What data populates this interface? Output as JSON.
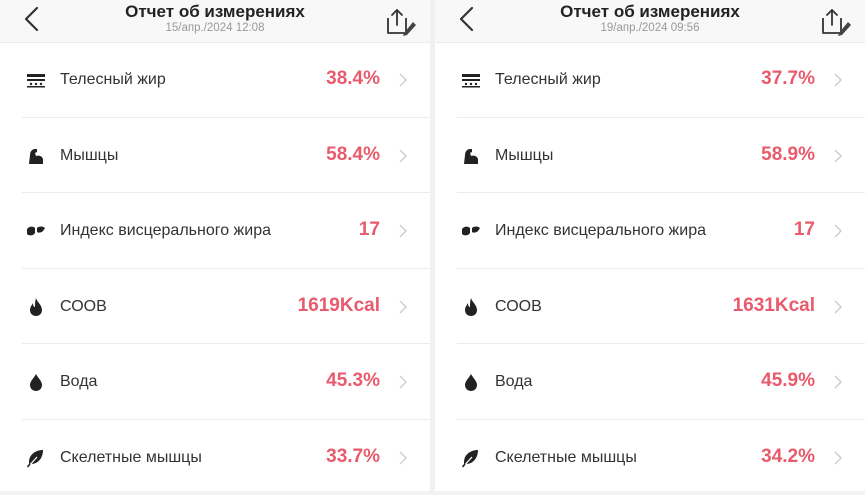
{
  "colors": {
    "value_red": "#e95b6c",
    "label_dark": "#333333",
    "date_gray": "#999999",
    "chevron_gray": "#cccccc",
    "icon_dark": "#222222"
  },
  "panels": [
    {
      "title": "Отчет об измерениях",
      "date": "15/апр./2024 12:08",
      "back_icon": "chevron-left-icon",
      "share_icon": "share-edit-icon",
      "items": [
        {
          "icon": "body-fat-icon",
          "label": "Телесный жир",
          "value": "38.4%"
        },
        {
          "icon": "muscle-icon",
          "label": "Мышцы",
          "value": "58.4%"
        },
        {
          "icon": "visceral-fat-icon",
          "label": "Индекс висцерального жира",
          "value": "17"
        },
        {
          "icon": "flame-icon",
          "label": "СООВ",
          "value": "1619Kcal"
        },
        {
          "icon": "water-drop-icon",
          "label": "Вода",
          "value": "45.3%"
        },
        {
          "icon": "leaf-icon",
          "label": "Скелетные мышцы",
          "value": "33.7%"
        }
      ]
    },
    {
      "title": "Отчет об измерениях",
      "date": "19/апр./2024 09:56",
      "back_icon": "chevron-left-icon",
      "share_icon": "share-edit-icon",
      "items": [
        {
          "icon": "body-fat-icon",
          "label": "Телесный жир",
          "value": "37.7%"
        },
        {
          "icon": "muscle-icon",
          "label": "Мышцы",
          "value": "58.9%"
        },
        {
          "icon": "visceral-fat-icon",
          "label": "Индекс висцерального жира",
          "value": "17"
        },
        {
          "icon": "flame-icon",
          "label": "СООВ",
          "value": "1631Kcal"
        },
        {
          "icon": "water-drop-icon",
          "label": "Вода",
          "value": "45.9%"
        },
        {
          "icon": "leaf-icon",
          "label": "Скелетные мышцы",
          "value": "34.2%"
        }
      ]
    }
  ]
}
